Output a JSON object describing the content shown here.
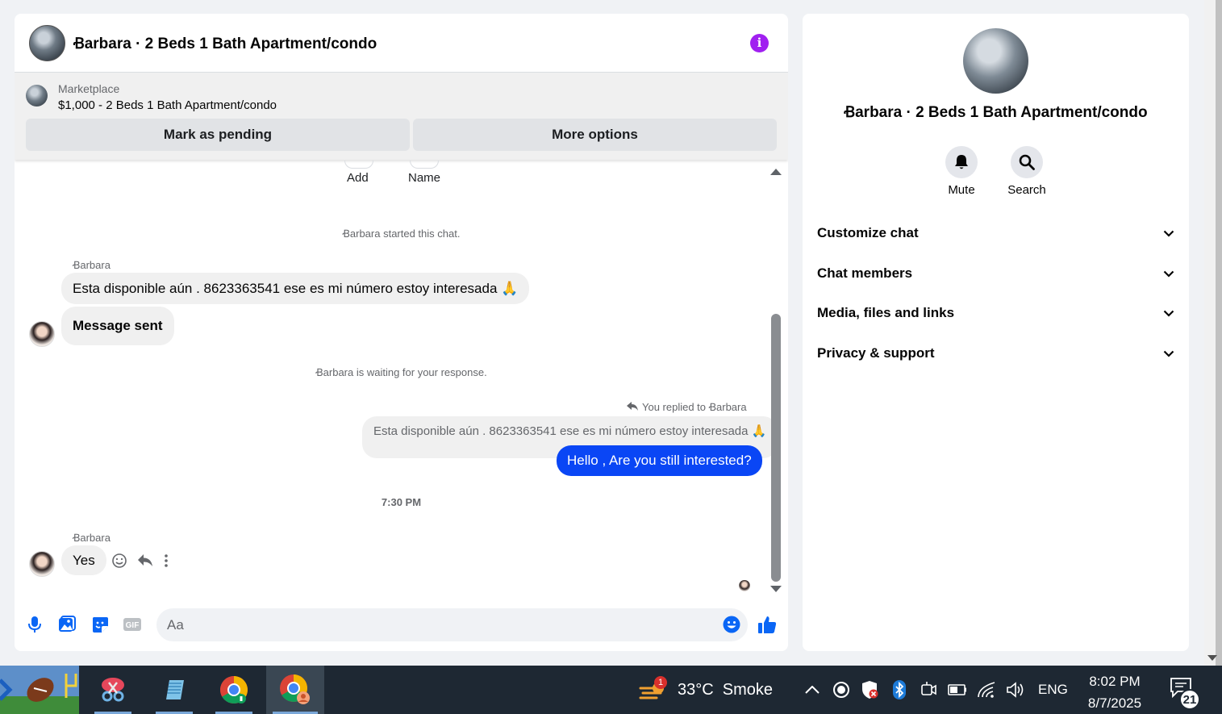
{
  "chat": {
    "title": "Ꞗarbara · 2 Beds 1 Bath Apartment/condo",
    "listing": {
      "source": "Marketplace",
      "price_title": "$1,000 - 2 Beds 1 Bath Apartment/condo",
      "pending_label": "Mark as pending",
      "more_label": "More options"
    },
    "actions": {
      "add": "Add",
      "name": "Name"
    },
    "started": "Ꞗarbara started this chat.",
    "sender1": "Ꞗarbara",
    "msg1": "Esta disponible aún . 8623363541 ese es mi número estoy interesada 🙏",
    "msg2": "Message sent",
    "waiting": "Ꞗarbara is waiting for your response.",
    "replied": "You replied to Ꞗarbara",
    "quoted": "Esta disponible aún . 8623363541 ese es mi número estoy interesada 🙏",
    "reply": "Hello , Are you still interested?",
    "time": "7:30 PM",
    "sender2": "Ꞗarbara",
    "msg3": "Yes",
    "input_placeholder": "Aa"
  },
  "info": {
    "title": "Ꞗarbara · 2 Beds 1 Bath Apartment/condo",
    "mute": "Mute",
    "search": "Search",
    "sections": [
      "Customize chat",
      "Chat members",
      "Media, files and links",
      "Privacy & support"
    ]
  },
  "taskbar": {
    "weather_badge": "1",
    "weather": "33°C  Smoke",
    "lang": "ENG",
    "time": "8:02 PM",
    "date": "8/7/2025",
    "notifications": "21"
  },
  "colors": {
    "accent": "#0a46f5",
    "info": "#a020f0",
    "taskbar": "#1e2833"
  }
}
